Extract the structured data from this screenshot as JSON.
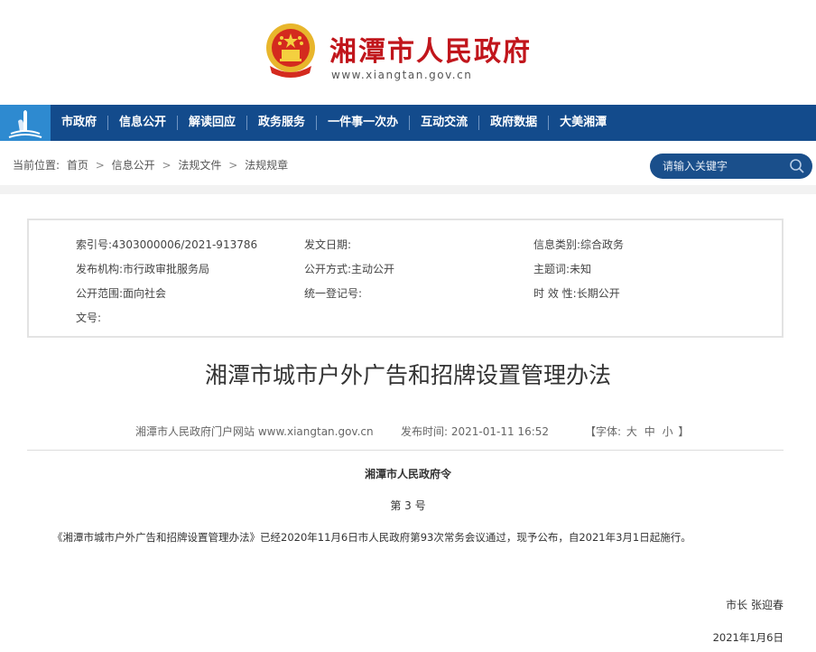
{
  "header": {
    "site_title": "湘潭市人民政府",
    "site_url": "www.xiangtan.gov.cn",
    "emblem_icon": "national-emblem-icon"
  },
  "nav": {
    "logo_icon": "xiangtan-tower-logo-icon",
    "items": [
      "市政府",
      "信息公开",
      "解读回应",
      "政务服务",
      "一件事一次办",
      "互动交流",
      "政府数据",
      "大美湘潭"
    ]
  },
  "breadcrumb": {
    "label": "当前位置:",
    "items": [
      "首页",
      "信息公开",
      "法规文件",
      "法规规章"
    ],
    "separator": ">"
  },
  "search": {
    "placeholder": "请输入关键字",
    "icon": "search-icon"
  },
  "info": {
    "index_no_label": "索引号:",
    "index_no": "4303000006/2021-913786",
    "issue_date_label": "发文日期:",
    "issue_date": "",
    "category_label": "信息类别:",
    "category": "综合政务",
    "publisher_label": "发布机构:",
    "publisher": "市行政审批服务局",
    "open_mode_label": "公开方式:",
    "open_mode": "主动公开",
    "subject_label": "主题词:",
    "subject": "未知",
    "scope_label": "公开范围:",
    "scope": "面向社会",
    "reg_no_label": "统一登记号:",
    "reg_no": "",
    "validity_label": "时 效 性:",
    "validity": "长期公开",
    "doc_no_label": "文号:",
    "doc_no": ""
  },
  "article": {
    "title": "湘潭市城市户外广告和招牌设置管理办法",
    "source": "湘潭市人民政府门户网站 www.xiangtan.gov.cn",
    "publish_label": "发布时间:",
    "publish_time": "2021-01-11 16:52",
    "font_label_open": "【字体:",
    "font_large": "大",
    "font_medium": "中",
    "font_small": "小",
    "font_label_close": "】",
    "decree": "湘潭市人民政府令",
    "decree_no": "第 3 号",
    "body": "《湘潭市城市户外广告和招牌设置管理办法》已经2020年11月6日市人民政府第93次常务会议通过，现予公布，自2021年3月1日起施行。",
    "signer": "市长  张迎春",
    "date": "2021年1月6日"
  },
  "colors": {
    "brand_red": "#c1161c",
    "nav_blue": "#134b8c",
    "nav_logo_blue": "#2e8ad0",
    "emblem_gold": "#e8b62c"
  }
}
